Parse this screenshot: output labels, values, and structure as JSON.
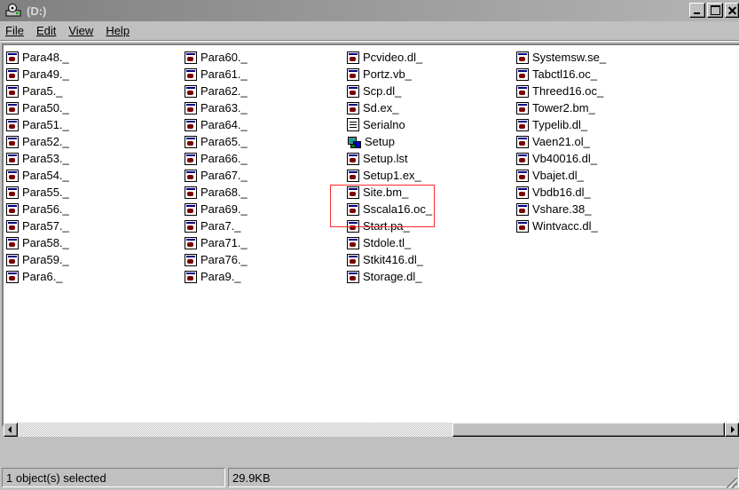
{
  "window": {
    "title": "(D:)"
  },
  "menu": {
    "items": [
      "File",
      "Edit",
      "View",
      "Help"
    ]
  },
  "columns": [
    [
      "Para48._",
      "Para49._",
      "Para5._",
      "Para50._",
      "Para51._",
      "Para52._",
      "Para53._",
      "Para54._",
      "Para55._",
      "Para56._",
      "Para57._",
      "Para58._",
      "Para59._",
      "Para6._"
    ],
    [
      "Para60._",
      "Para61._",
      "Para62._",
      "Para63._",
      "Para64._",
      "Para65._",
      "Para66._",
      "Para67._",
      "Para68._",
      "Para69._",
      "Para7._",
      "Para71._",
      "Para76._",
      "Para9._"
    ],
    [
      "Pcvideo.dl_",
      "Portz.vb_",
      "Scp.dl_",
      "Sd.ex_",
      "Serialno",
      "Setup",
      "Setup.lst",
      "Setup1.ex_",
      "Site.bm_",
      "Sscala16.oc_",
      "Start.pa_",
      "Stdole.tl_",
      "Stkit416.dl_",
      "Storage.dl_"
    ],
    [
      "Systemsw.se_",
      "Tabctl16.oc_",
      "Threed16.oc_",
      "Tower2.bm_",
      "Typelib.dl_",
      "Vaen21.ol_",
      "Vb40016.dl_",
      "Vbajet.dl_",
      "Vbdb16.dl_",
      "Vshare.38_",
      "Wintvacc.dl_"
    ]
  ],
  "icons": {
    "generic": "compressed-file-icon",
    "Serialno": "text-file-icon",
    "Setup": "setup-program-icon"
  },
  "status": {
    "selection": "1 object(s) selected",
    "size": "29.9KB"
  },
  "colors": {
    "highlight_box": "#ff2a2a",
    "titlebar_inactive": "#808080"
  }
}
